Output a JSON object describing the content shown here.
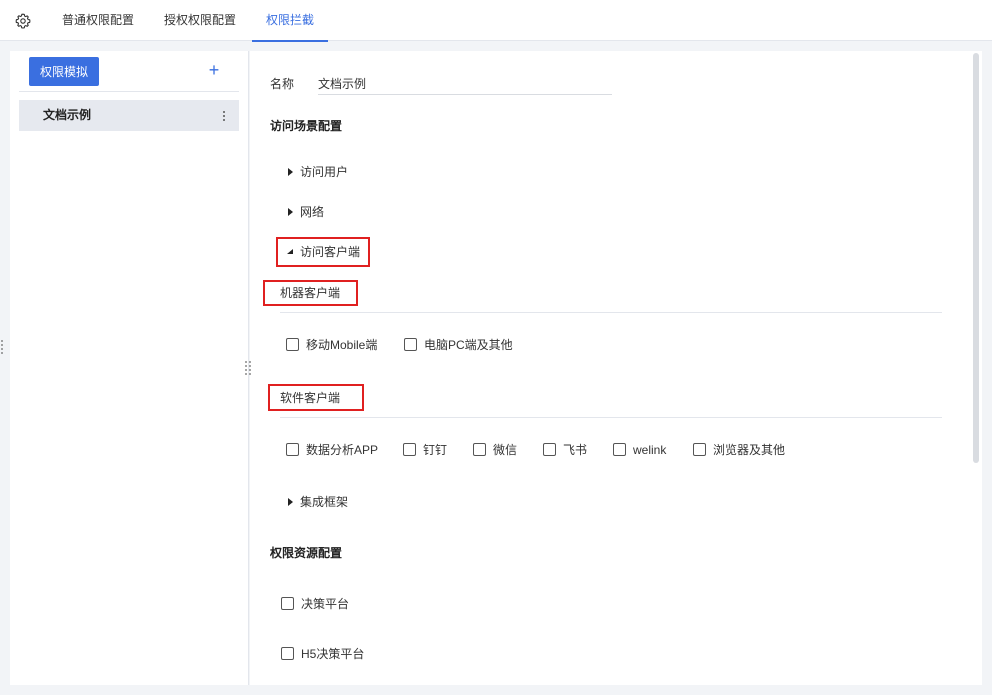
{
  "tabs": [
    {
      "label": "普通权限配置"
    },
    {
      "label": "授权权限配置"
    },
    {
      "label": "权限拦截"
    }
  ],
  "sidebar": {
    "simulate_button": "权限模拟",
    "add_icon": "plus-icon",
    "items": [
      {
        "label": "文档示例"
      }
    ]
  },
  "form": {
    "name_label": "名称",
    "name_value": "文档示例",
    "scene_title": "访问场景配置",
    "access_user": "访问用户",
    "network": "网络",
    "access_client": "访问客户端",
    "machine_client": "机器客户端",
    "machine_options": [
      "移动Mobile端",
      "电脑PC端及其他"
    ],
    "software_client": "软件客户端",
    "software_options": [
      "数据分析APP",
      "钉钉",
      "微信",
      "飞书",
      "welink",
      "浏览器及其他"
    ],
    "framework": "集成框架",
    "resource_title": "权限资源配置",
    "resource_options": [
      "决策平台",
      "H5决策平台"
    ]
  },
  "colors": {
    "accent": "#3a6fe0",
    "highlight": "#e02020"
  }
}
